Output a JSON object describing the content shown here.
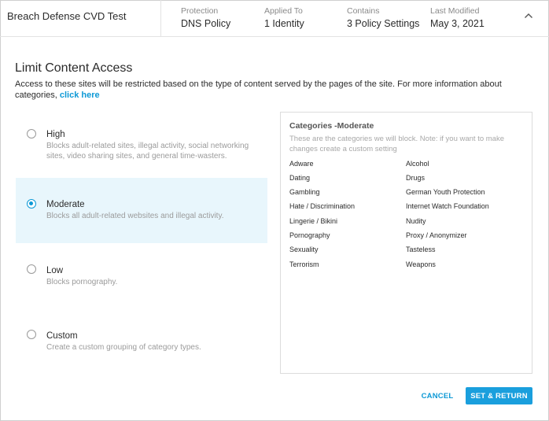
{
  "header": {
    "policy_name": "Breach Defense CVD Test",
    "meta": [
      {
        "label": "Protection",
        "value": "DNS Policy"
      },
      {
        "label": "Applied To",
        "value": "1 Identity"
      },
      {
        "label": "Contains",
        "value": "3 Policy Settings"
      },
      {
        "label": "Last Modified",
        "value": "May 3, 2021"
      }
    ],
    "collapse_icon": "chevron-up-icon"
  },
  "section": {
    "title": "Limit Content Access",
    "description": "Access to these sites will be restricted based on the type of content served by the pages of the site. For more information about categories,",
    "link_text": "click here"
  },
  "options": [
    {
      "title": "High",
      "description": "Blocks adult-related sites, illegal activity, social networking sites, video sharing sites, and general time-wasters.",
      "selected": false
    },
    {
      "title": "Moderate",
      "description": "Blocks all adult-related websites and illegal activity.",
      "selected": true
    },
    {
      "title": "Low",
      "description": "Blocks pornography.",
      "selected": false
    },
    {
      "title": "Custom",
      "description": "Create a custom grouping of category types.",
      "selected": false
    }
  ],
  "panel": {
    "title": "Categories -Moderate",
    "note": "These are the categories we will block. Note: if you want to make changes create a custom setting",
    "categories_left": [
      "Adware",
      "Dating",
      "Gambling",
      "Hate / Discrimination",
      "Lingerie / Bikini",
      "Pornography",
      "Sexuality",
      "Terrorism"
    ],
    "categories_right": [
      "Alcohol",
      "Drugs",
      "German Youth Protection",
      "Internet Watch Foundation",
      "Nudity",
      "Proxy / Anonymizer",
      "Tasteless",
      "Weapons"
    ]
  },
  "footer": {
    "cancel_label": "CANCEL",
    "submit_label": "SET & RETURN"
  },
  "colors": {
    "accent": "#0d99d6",
    "selected_bg": "#e8f6fc",
    "button_bg": "#1a9fdd"
  }
}
